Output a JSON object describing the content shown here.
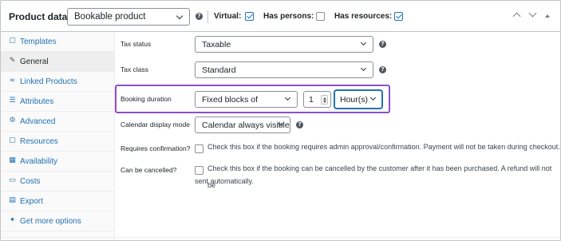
{
  "header": {
    "title": "Product data —",
    "product_type": "Bookable product",
    "virtual_label": "Virtual:",
    "virtual_checked": true,
    "has_persons_label": "Has persons:",
    "has_persons_checked": false,
    "has_resources_label": "Has resources:",
    "has_resources_checked": true,
    "help_icon": "question-icon",
    "controls": [
      "move-up-icon",
      "move-down-icon",
      "collapse-icon"
    ]
  },
  "sidebar": {
    "items": [
      {
        "label": "Templates",
        "icon": "template-icon",
        "active": false
      },
      {
        "label": "General",
        "icon": "wrench-icon",
        "active": true
      },
      {
        "label": "Linked Products",
        "icon": "link-icon",
        "active": false
      },
      {
        "label": "Attributes",
        "icon": "list-icon",
        "active": false
      },
      {
        "label": "Advanced",
        "icon": "gear-icon",
        "active": false
      },
      {
        "label": "Resources",
        "icon": "resources-icon",
        "active": false
      },
      {
        "label": "Availability",
        "icon": "calendar-icon",
        "active": false
      },
      {
        "label": "Costs",
        "icon": "money-icon",
        "active": false
      },
      {
        "label": "Export",
        "icon": "export-icon",
        "active": false
      },
      {
        "label": "Get more options",
        "icon": "plugin-icon",
        "active": false
      }
    ]
  },
  "main": {
    "tax_status": {
      "label": "Tax status",
      "value": "Taxable"
    },
    "tax_class": {
      "label": "Tax class",
      "value": "Standard"
    },
    "booking_duration": {
      "label": "Booking duration",
      "type_value": "Fixed blocks of",
      "number_value": "1",
      "unit_value": "Hour(s)"
    },
    "calendar_display": {
      "label": "Calendar display mode",
      "value": "Calendar always visible"
    },
    "requires_confirmation": {
      "label": "Requires confirmation?",
      "checked": false,
      "text": "Check this box if the booking requires admin approval/confirmation. Payment will not be taken during checkout."
    },
    "can_be_cancelled": {
      "label": "Can be cancelled?",
      "checked": false,
      "text_line1": "Check this box if the booking can be cancelled by the customer after it has been purchased. A refund will not be",
      "text_line2": "sent automatically."
    }
  },
  "colors": {
    "accent": "#2271b1",
    "highlight": "#8d4ec9",
    "sidebar_bg": "#fafafa"
  }
}
